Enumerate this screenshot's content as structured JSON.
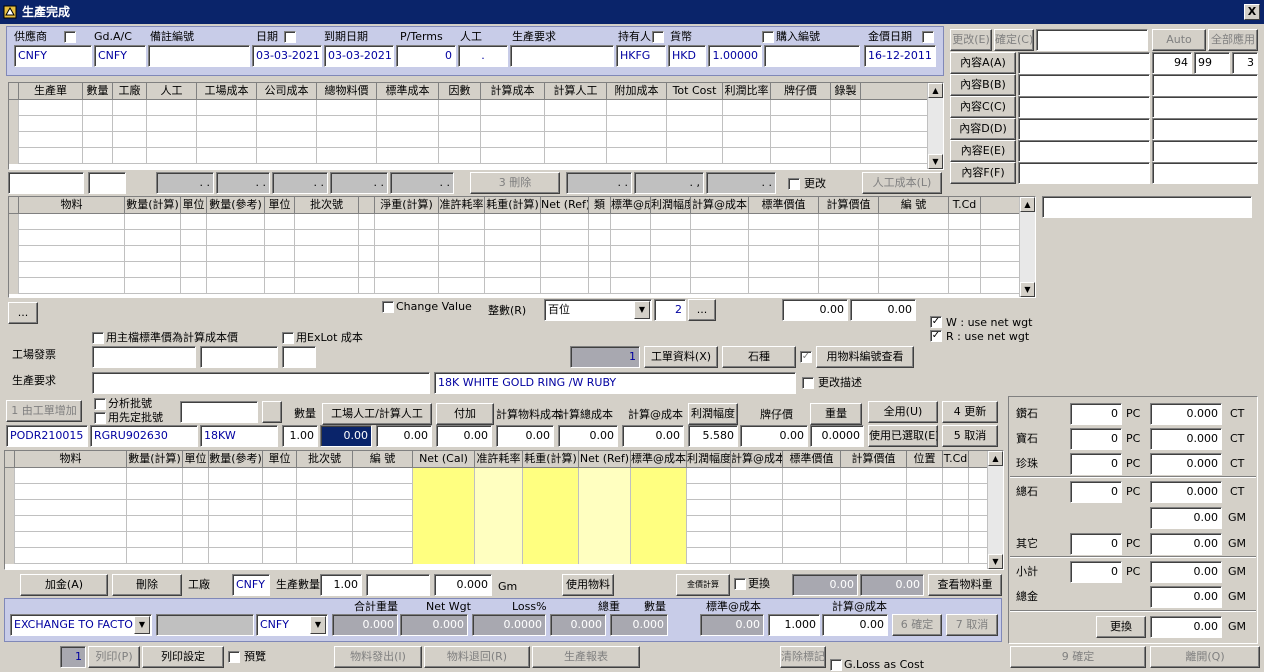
{
  "window": {
    "title": "生產完成",
    "close": "X"
  },
  "header": {
    "supplier_label": "供應商",
    "gdac_label": "Gd.A/C",
    "remark_label": "備註編號",
    "date_label": "日期",
    "due_label": "到期日期",
    "pterms_label": "P/Terms",
    "labor_label": "人工",
    "req_label": "生產要求",
    "holder_label": "持有人",
    "currency_label": "貨幣",
    "purchase_label": "購入編號",
    "price_date_label": "金價日期",
    "supplier": "CNFY",
    "gdac": "CNFY",
    "remark": "",
    "date": "03-03-2021",
    "due": "03-03-2021",
    "pterms": "0",
    "labor": ".",
    "req": "",
    "holder": "HKFG",
    "currency": "HKD",
    "rate": "1.00000",
    "purchase": "",
    "price_date": "16-12-2011"
  },
  "right_top": {
    "change": "更改(E)",
    "confirm": "確定(C)",
    "auto": "Auto",
    "apply_all": "全部應用",
    "v1": "94",
    "v2": "99",
    "v3": "3",
    "contents": [
      "內容A(A)",
      "內容B(B)",
      "內容C(C)",
      "內容D(D)",
      "內容E(E)",
      "內容F(F)"
    ]
  },
  "grid1": {
    "cols": [
      "生產單",
      "數量",
      "工廠",
      "人工",
      "工場成本",
      "公司成本",
      "總物料價",
      "標準成本",
      "因數",
      "計算成本",
      "計算人工",
      "附加成本",
      "Tot Cost",
      "利潤比率",
      "牌仔價",
      "錄製"
    ]
  },
  "row1": {
    "delete": "3 刪除",
    "change": "更改",
    "labor_cost": "人工成本(L)",
    "f1": ". .",
    "f2": ". .",
    "f3": ". .",
    "f4": ". .",
    "f5": ". .",
    "f6": ". .",
    "f7": ". ,",
    "f8": ". ."
  },
  "grid2": {
    "cols_left": [
      "物料",
      "數量(計算)",
      "單位",
      "數量(參考)",
      "單位",
      "批次號"
    ],
    "cols_right": [
      "淨重(計算)",
      "准許耗率",
      "耗重(計算)",
      "Net (Ref)",
      "類",
      "標準@成本",
      "利潤幅度",
      "計算@成本",
      "標準價值",
      "計算價值",
      "編 號",
      "T.Cd"
    ]
  },
  "mid": {
    "dots": "...",
    "change_value": "Change Value",
    "round_label": "整數(R)",
    "round": "百位",
    "round_n": "2",
    "dots2": "...",
    "v1": "0.00",
    "v2": "0.00",
    "w_label": "W : use net wgt",
    "r_label": "R : use net wgt",
    "use_master": "用主檔標準價為計算成本價",
    "use_exlot": "用ExLot 成本",
    "factory_inv_label": "工場發票",
    "req_label": "生產要求",
    "order_no": "1",
    "order_info": "工單資料(X)",
    "stone": "石種",
    "material_lookup": "用物料編號查看",
    "desc": "18K WHITE GOLD RING /W RUBY",
    "change_desc": "更改描述",
    "add_order": "1 由工單增加",
    "split_batch": "分析批號",
    "use_first": "用先定批號",
    "qty_label": "數量",
    "labor_calc": "工場人工/計算人工",
    "addon": "付加",
    "mat_cost": "計算物料成本",
    "total_cost": "計算總成本",
    "unit_cost": "計算@成本",
    "margin": "利潤幅度",
    "tag_price": "牌仔價",
    "weight": "重量",
    "use_all": "全用(U)",
    "update": "4 更新",
    "use_selected": "使用已選取(E)",
    "cancel": "5 取消",
    "po": "PODR210015",
    "item": "RGRU902630",
    "kt": "18KW",
    "qty": "1.00",
    "labor": "0.00",
    "addon_v": "0.00",
    "mat_v": "0.00",
    "tot_v": "0.00",
    "unit_v": "0.00",
    "margin_v": "5.580",
    "tag_v": "0.00",
    "weight_v": "0.0000"
  },
  "grid3": {
    "cols": [
      "物料",
      "數量(計算)",
      "單位",
      "數量(參考)",
      "單位",
      "批次號",
      "編 號",
      "Net (Cal)",
      "准許耗率",
      "耗重(計算)",
      "Net (Ref)",
      "標準@成本",
      "利潤幅度",
      "計算@成本",
      "標準價值",
      "計算價值",
      "位置",
      "T.Cd"
    ]
  },
  "lower": {
    "add_gold": "加金(A)",
    "delete": "刪除",
    "factory": "工廠",
    "factory_v": "CNFY",
    "prod_qty": "生產數量",
    "prod_qty_v": "1.00",
    "gm_v": "0.000",
    "gm": "Gm",
    "use_mat": "使用物料",
    "gold_calc": "金價計算",
    "replace": "更換",
    "z1": "0.00",
    "z2": "0.00",
    "view_weight": "查看物料重",
    "sum_weight": "合計重量",
    "net_wgt": "Net Wgt",
    "loss": "Loss%",
    "gross": "總重",
    "count": "數量",
    "std_cost": "標準@成本",
    "calc_cost": "計算@成本",
    "exchange": "EXCHANGE TO FACTORY",
    "cur": "CNFY",
    "s1": "0.000",
    "s2": "0.000",
    "s3": "0.0000",
    "s4": "0.000",
    "s5": "0.000",
    "s6": "0.00",
    "s7": "1.000",
    "s8": "0.00",
    "confirm6": "6 確定",
    "cancel7": "7 取消"
  },
  "footer": {
    "copies": "1",
    "print": "列印(P)",
    "print_setup": "列印設定",
    "preview": "預覽",
    "mat_out": "物料發出(I)",
    "mat_ret": "物料退回(R)",
    "prod_report": "生產報表",
    "clear_mark": "清除標記",
    "gloss": "G.Loss as Cost",
    "confirm9": "9 確定",
    "leave": "離開(Q)"
  },
  "summary": {
    "rows": [
      {
        "label": "鑽石",
        "pc": "0",
        "unit": "PC",
        "val": "0.000",
        "u2": "CT"
      },
      {
        "label": "寶石",
        "pc": "0",
        "unit": "PC",
        "val": "0.000",
        "u2": "CT"
      },
      {
        "label": "珍珠",
        "pc": "0",
        "unit": "PC",
        "val": "0.000",
        "u2": "CT"
      }
    ],
    "total_stone": "總石",
    "ts_pc": "0",
    "ts_val": "0.000",
    "ts_gm": "0.00",
    "other": "其它",
    "other_pc": "0",
    "other_val": "0.00",
    "subtotal": "小計",
    "sub_pc": "0",
    "sub_val": "0.00",
    "gold": "總金",
    "gold_val": "0.00",
    "swap": "更換",
    "swap_val": "0.00",
    "PC": "PC",
    "CT": "CT",
    "GM": "GM"
  }
}
